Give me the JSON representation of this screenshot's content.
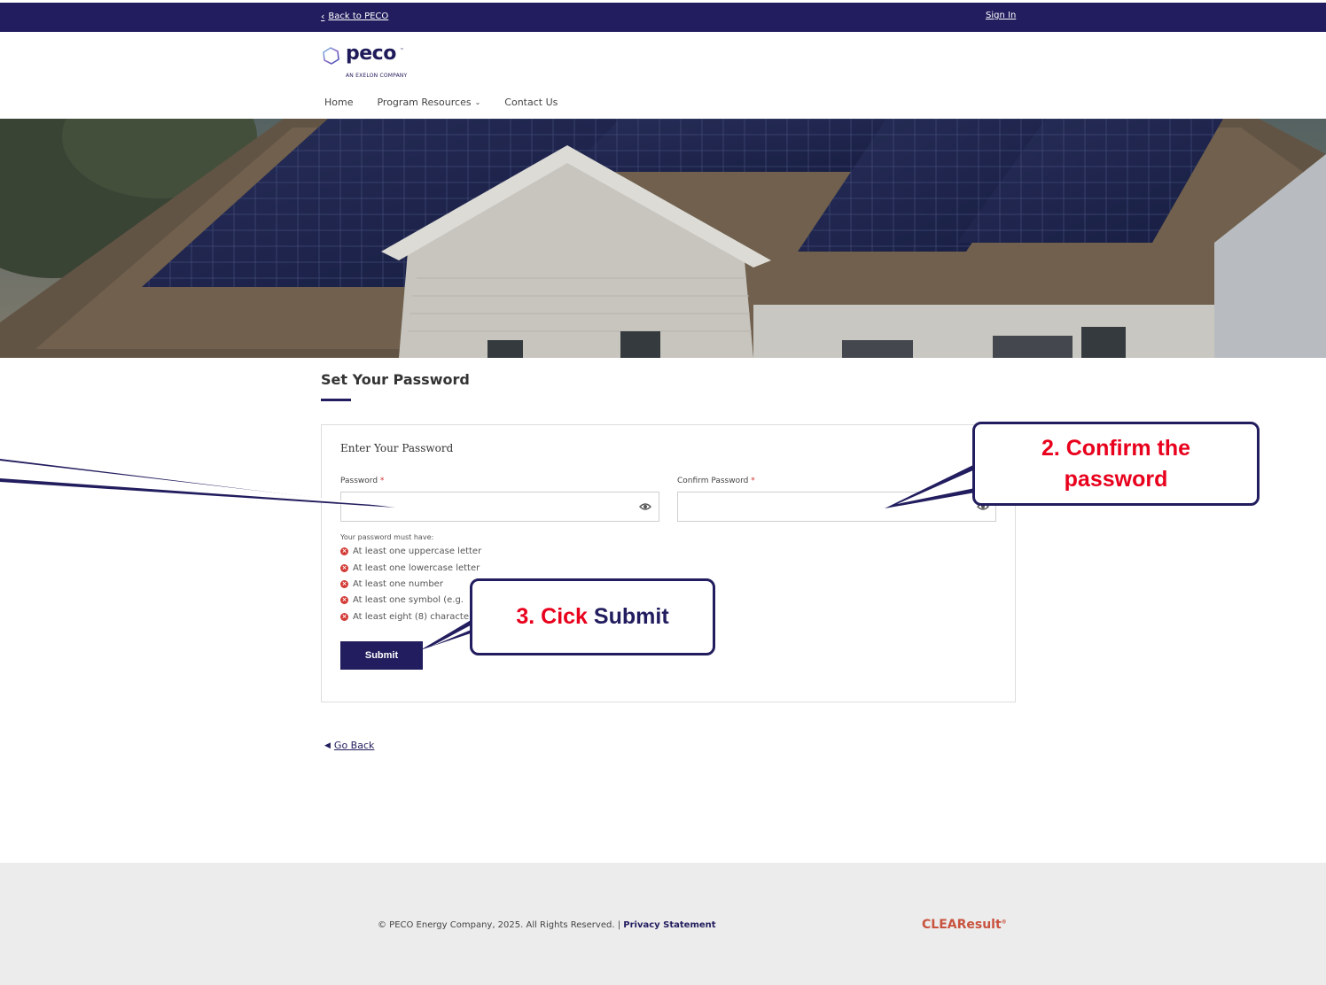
{
  "topbar": {
    "back_label": "Back to PECO",
    "sign_in_label": "Sign In"
  },
  "brand": {
    "name": "peco",
    "trademark": "™",
    "tagline": "AN EXELON COMPANY"
  },
  "nav": {
    "home": "Home",
    "program_resources": "Program Resources",
    "contact_us": "Contact Us"
  },
  "hero": {
    "icon": "solar-panel-roof-photo"
  },
  "page": {
    "title": "Set Your Password"
  },
  "form": {
    "heading": "Enter Your Password",
    "password_label": "Password",
    "confirm_label": "Confirm Password",
    "required_mark": "*",
    "password_value": "",
    "confirm_value": "",
    "rules_heading": "Your password must have:",
    "rules": [
      "At least one uppercase letter",
      "At least one lowercase letter",
      "At least one number",
      "At least one symbol (e.g.",
      "At least eight (8) characte"
    ],
    "submit_label": "Submit"
  },
  "go_back_label": "Go Back",
  "footer": {
    "copyright": "© PECO Energy Company, 2025. All Rights Reserved.",
    "separator": "|",
    "privacy_label": "Privacy Statement",
    "partner_logo": "CLEAResult",
    "partner_mark": "®"
  },
  "annotations": {
    "step2_line1": "2. Confirm the",
    "step2_line2": "password",
    "step3_prefix": "3. Cick",
    "step3_word": "Submit"
  },
  "colors": {
    "brand_navy": "#221d5e",
    "annotation_red": "#e8001c",
    "error_red": "#d33b36",
    "partner_orange": "#c8533f"
  }
}
